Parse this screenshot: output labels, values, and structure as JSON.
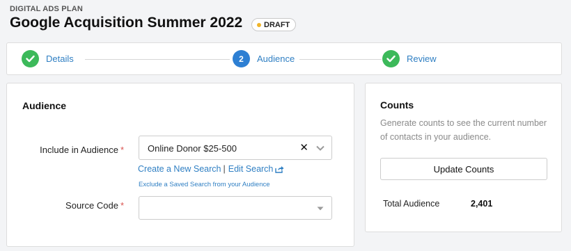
{
  "header": {
    "eyebrow": "DIGITAL ADS PLAN",
    "title": "Google Acquisition Summer 2022",
    "status_badge": "DRAFT",
    "status_dot_color": "#f0b429"
  },
  "steps": [
    {
      "label": "Details",
      "state": "complete",
      "icon": "check-icon"
    },
    {
      "label": "Audience",
      "state": "active",
      "number": "2"
    },
    {
      "label": "Review",
      "state": "complete",
      "icon": "check-icon"
    }
  ],
  "audience_card": {
    "heading": "Audience",
    "include_field": {
      "label": "Include in Audience",
      "required_mark": "*",
      "value": "Online Donor $25-500",
      "clear_icon": "close-icon",
      "dropdown_icon": "chevron-down-icon"
    },
    "links": {
      "create": "Create a New Search",
      "separator": "|",
      "edit": "Edit Search",
      "edit_icon": "share-icon",
      "exclude": "Exclude a Saved Search from your Audience"
    },
    "source_field": {
      "label": "Source Code",
      "required_mark": "*",
      "value": "",
      "dropdown_icon": "chevron-down-icon"
    }
  },
  "counts_card": {
    "heading": "Counts",
    "description": "Generate counts to see the current number of contacts in your audience.",
    "button_label": "Update Counts",
    "total_label": "Total Audience",
    "total_value": "2,401"
  },
  "colors": {
    "complete": "#3cb95a",
    "active": "#2d7fd3",
    "link": "#2f7fc3",
    "required": "#d9534f"
  }
}
